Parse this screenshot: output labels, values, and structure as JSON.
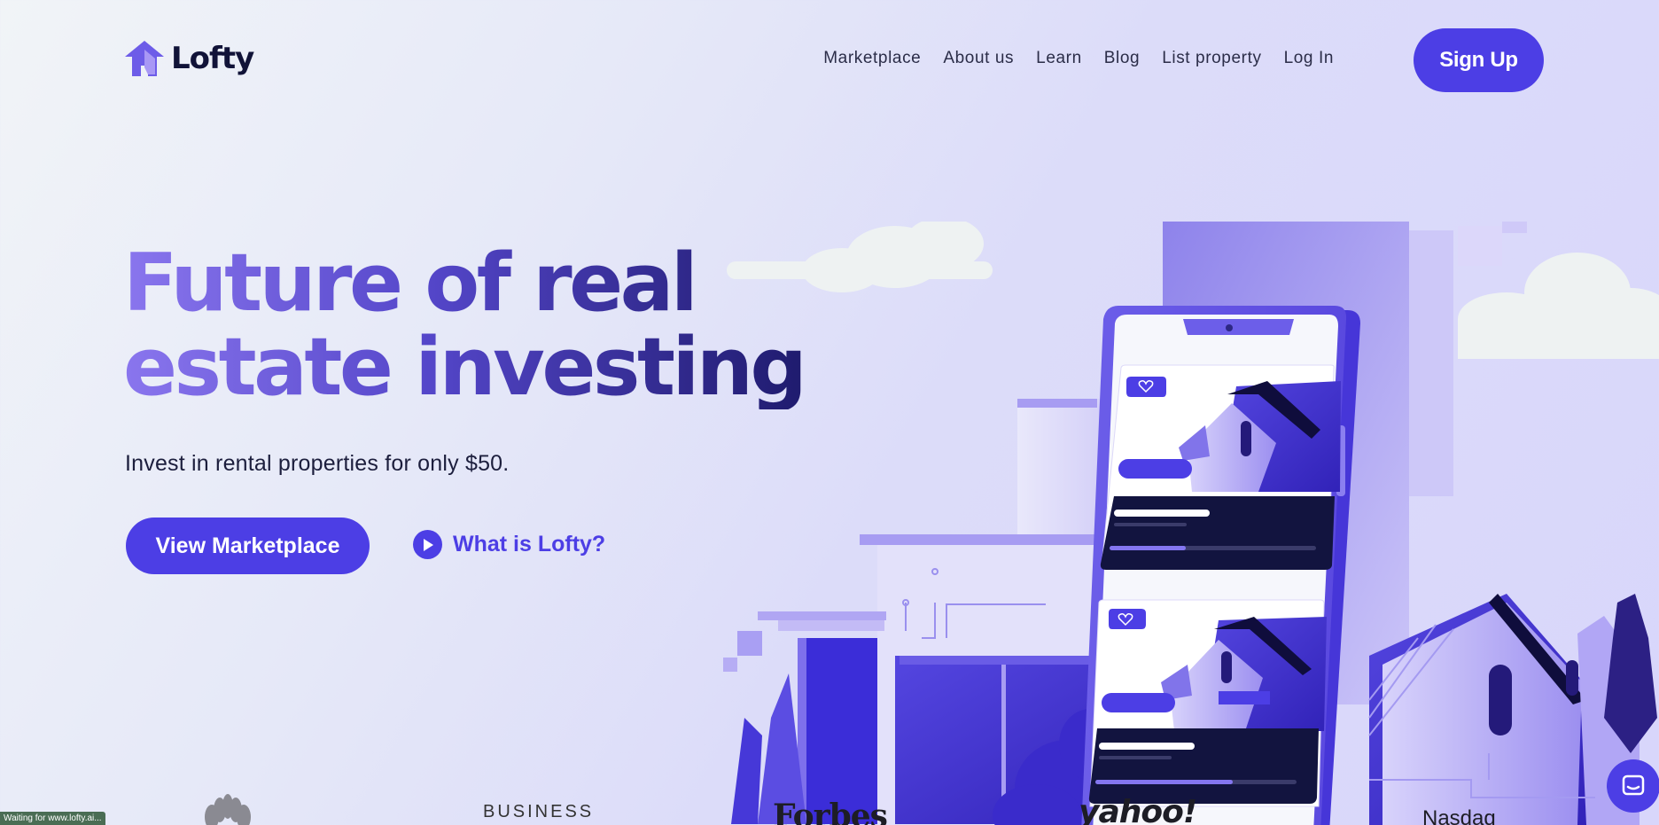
{
  "nav": {
    "brand": "Lofty",
    "links": [
      "Marketplace",
      "About us",
      "Learn",
      "Blog",
      "List property",
      "Log In"
    ],
    "signup_label": "Sign Up"
  },
  "hero": {
    "title_line1": "Future of real",
    "title_line2": "estate investing",
    "subtitle": "Invest in rental properties for only $50.",
    "cta_label": "View Marketplace",
    "secondary_label": "What is Lofty?"
  },
  "press": {
    "business_insider": "BUSINESS\nINSIDER",
    "business_insider_visible": "BUSINESS",
    "forbes": "Forbes",
    "yahoo": "yahoo!",
    "nasdaq": "Nasdaq"
  },
  "status_bar": "Waiting for www.lofty.ai...",
  "colors": {
    "accent": "#4c3ee5",
    "heading_dark": "#1f1b6e",
    "heading_light": "#8a76ee",
    "text": "#14163b"
  },
  "icons": [
    "lofty-logo-icon",
    "play-icon",
    "nbc-peacock-icon",
    "chat-icon",
    "heart-icon"
  ]
}
